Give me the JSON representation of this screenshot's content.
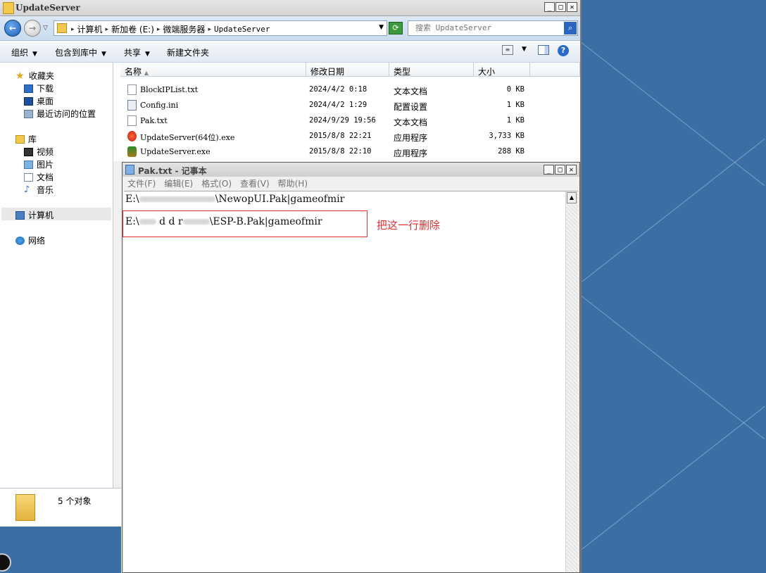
{
  "explorer": {
    "title": "UpdateServer",
    "address": {
      "crumbs": [
        "计算机",
        "新加卷 (E:)",
        "微端服务器",
        "UpdateServer"
      ]
    },
    "search_placeholder": "搜索 UpdateServer",
    "toolbar": {
      "organize": "组织",
      "include_in_library": "包含到库中",
      "share": "共享",
      "new_folder": "新建文件夹"
    },
    "nav": {
      "favorites": "收藏夹",
      "downloads": "下载",
      "desktop": "桌面",
      "recent": "最近访问的位置",
      "libraries": "库",
      "videos": "视频",
      "pictures": "图片",
      "documents": "文档",
      "music": "音乐",
      "computer": "计算机",
      "network": "网络"
    },
    "columns": {
      "name": "名称",
      "modified": "修改日期",
      "type": "类型",
      "size": "大小"
    },
    "files": [
      {
        "name": "BlockIPList.txt",
        "modified": "2024/4/2 0:18",
        "type": "文本文档",
        "size": "0 KB",
        "icon": "text-file-icon"
      },
      {
        "name": "Config.ini",
        "modified": "2024/4/2 1:29",
        "type": "配置设置",
        "size": "1 KB",
        "icon": "config-file-icon"
      },
      {
        "name": "Pak.txt",
        "modified": "2024/9/29 19:56",
        "type": "文本文档",
        "size": "1 KB",
        "icon": "text-file-icon"
      },
      {
        "name": "UpdateServer(64位).exe",
        "modified": "2015/8/8 22:21",
        "type": "应用程序",
        "size": "3,733 KB",
        "icon": "exe-red-icon"
      },
      {
        "name": "UpdateServer.exe",
        "modified": "2015/8/8 22:10",
        "type": "应用程序",
        "size": "288 KB",
        "icon": "exe-green-icon"
      }
    ],
    "status": "5 个对象"
  },
  "notepad": {
    "title": "Pak.txt - 记事本",
    "menu": [
      "文件(F)",
      "编辑(E)",
      "格式(O)",
      "查看(V)",
      "帮助(H)"
    ],
    "line1": {
      "prefix": "E:\\",
      "suffix": "\\NewopUI.Pak|gameofmir"
    },
    "line2": {
      "prefix": "E:\\",
      "middle": "d d r",
      "suffix": "\\ESP-B.Pak|gameofmir"
    },
    "annotation": "把这一行删除"
  },
  "colors": {
    "desktop": "#3a6ea5",
    "annotation_red": "#e03030"
  }
}
